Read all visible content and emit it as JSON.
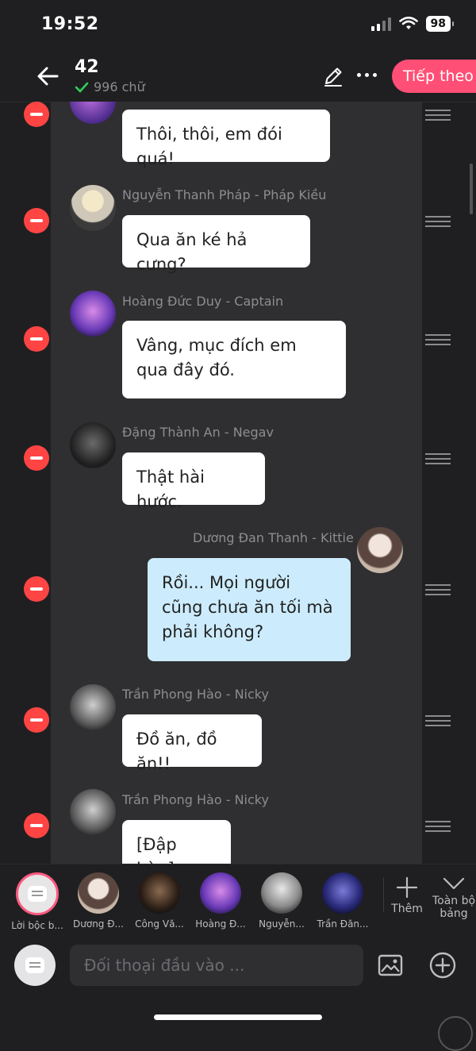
{
  "status": {
    "time": "19:52",
    "battery": "98"
  },
  "header": {
    "title": "42",
    "word_count": "996 chữ",
    "next_label": "Tiếp theo"
  },
  "messages": [
    {
      "name": "",
      "text": "Thôi, thôi, em đói quá!",
      "mine": false
    },
    {
      "name": "Nguyễn Thanh Pháp - Pháp Kiều",
      "text": "Qua ăn ké hả cưng?",
      "mine": false
    },
    {
      "name": "Hoàng Đức Duy - Captain",
      "text": "Vâng, mục đích em qua đây đó.",
      "mine": false
    },
    {
      "name": "Đặng Thành An - Negav",
      "text": "Thật hài hước.",
      "mine": false
    },
    {
      "name": "Dương Đan Thanh - Kittie",
      "text": "Rồi... Mọi người cũng chưa ăn tối mà phải không?",
      "mine": true
    },
    {
      "name": "Trần Phong Hào - Nicky",
      "text": "Đồ ăn, đồ ăn!!",
      "mine": false
    },
    {
      "name": "Trần Phong Hào - Nicky",
      "text": "[Đập bàn]",
      "mine": false
    }
  ],
  "characters": [
    {
      "label": "Lời bộc b..."
    },
    {
      "label": "Dương Đ..."
    },
    {
      "label": "Công Vă..."
    },
    {
      "label": "Hoàng Đ..."
    },
    {
      "label": "Nguyễn..."
    },
    {
      "label": "Trần Đăn..."
    }
  ],
  "actions": {
    "more_label": "Thêm",
    "board_label": "Toàn bộ bảng"
  },
  "input": {
    "placeholder": "Đối thoại đầu vào ..."
  },
  "colors": {
    "accent": "#ff4f76",
    "delete": "#ff4444",
    "mine_bubble": "#ccecfd",
    "panel": "#2f2f31"
  },
  "icons": [
    "back-icon",
    "check-icon",
    "pen-icon",
    "more-dots-icon",
    "minus-icon",
    "drag-handle-icon",
    "plus-icon",
    "chevron-down-icon",
    "image-icon",
    "add-circle-icon"
  ]
}
